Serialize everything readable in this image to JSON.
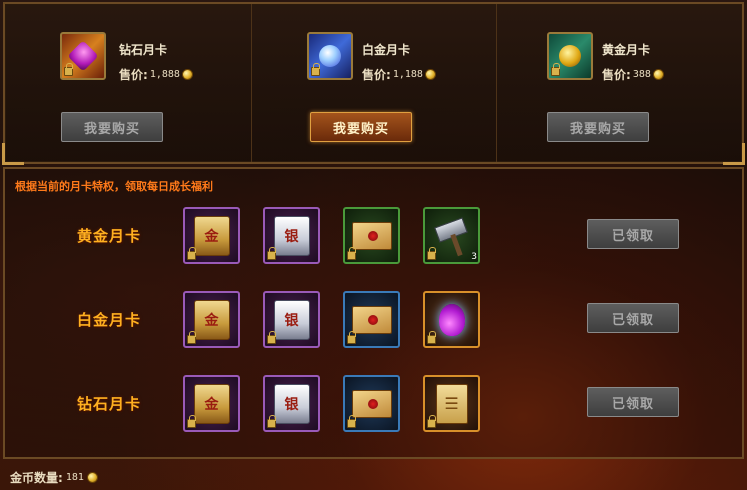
{
  "shop": {
    "cards": [
      {
        "name": "钻石月卡",
        "price_label": "售价:",
        "price": "1,888",
        "button": "我要购买",
        "button_state": "disabled"
      },
      {
        "name": "白金月卡",
        "price_label": "售价:",
        "price": "1,188",
        "button": "我要购买",
        "button_state": "active"
      },
      {
        "name": "黄金月卡",
        "price_label": "售价:",
        "price": "388",
        "button": "我要购买",
        "button_state": "disabled"
      }
    ]
  },
  "rewards": {
    "intro": "根据当前的月卡特权，领取每日成长福利",
    "rows": [
      {
        "label": "黄金月卡",
        "claim": "已领取",
        "item_count": "3"
      },
      {
        "label": "白金月卡",
        "claim": "已领取"
      },
      {
        "label": "钻石月卡",
        "claim": "已领取"
      }
    ],
    "icon_glyphs": {
      "gold": "金",
      "silver": "银"
    }
  },
  "footer": {
    "gold_label": "金币数量:",
    "gold_value": "181"
  },
  "colors": {
    "accent_orange": "#ff7a1a",
    "row_label": "#ffb020",
    "frame": "#6b4a24"
  }
}
